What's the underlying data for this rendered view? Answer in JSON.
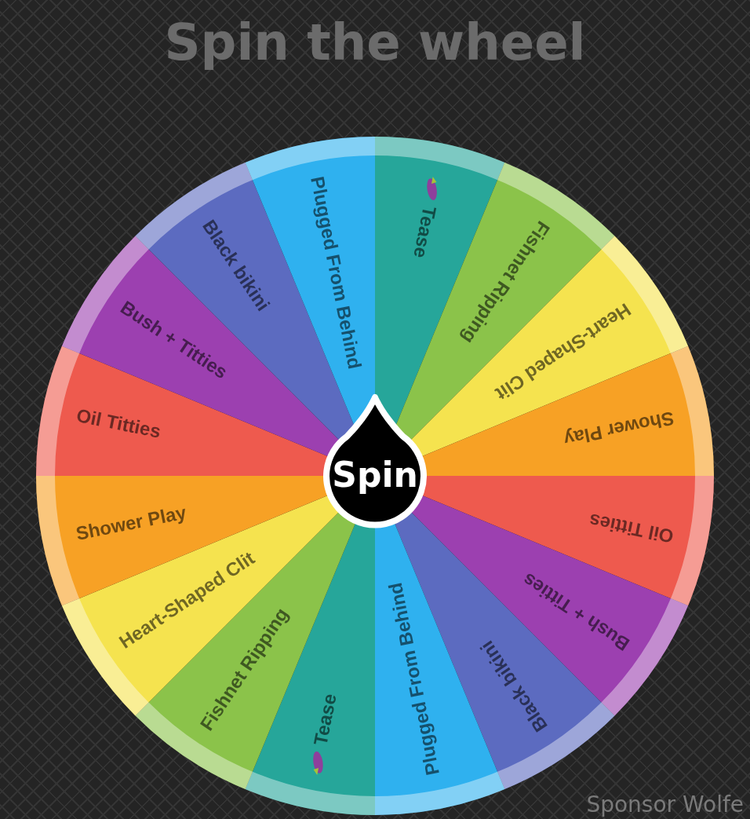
{
  "title": "Spin the wheel",
  "wheel": {
    "segments": [
      {
        "label": "Tease",
        "color": "#26a69a",
        "has_icon": true
      },
      {
        "label": "Fishnet Ripping",
        "color": "#8bc34a",
        "has_icon": false
      },
      {
        "label": "Heart-Shaped Clit",
        "color": "#f5e34f",
        "has_icon": false
      },
      {
        "label": "Shower Play",
        "color": "#f7a125",
        "has_icon": false
      },
      {
        "label": "Oil Titties",
        "color": "#ee5a4e",
        "has_icon": false
      },
      {
        "label": "Bush + Titties",
        "color": "#9c40b0",
        "has_icon": false
      },
      {
        "label": "Black bikini",
        "color": "#5c6bc0",
        "has_icon": false
      },
      {
        "label": "Plugged From Behind",
        "color": "#2fb1ef",
        "has_icon": false
      },
      {
        "label": "Tease",
        "color": "#26a69a",
        "has_icon": true
      },
      {
        "label": "Fishnet Ripping",
        "color": "#8bc34a",
        "has_icon": false
      },
      {
        "label": "Heart-Shaped Clit",
        "color": "#f5e34f",
        "has_icon": false
      },
      {
        "label": "Shower Play",
        "color": "#f7a125",
        "has_icon": false
      },
      {
        "label": "Oil Titties",
        "color": "#ee5a4e",
        "has_icon": false
      },
      {
        "label": "Bush + Titties",
        "color": "#9c40b0",
        "has_icon": false
      },
      {
        "label": "Black bikini",
        "color": "#5c6bc0",
        "has_icon": false
      },
      {
        "label": "Plugged From Behind",
        "color": "#2fb1ef",
        "has_icon": false
      }
    ],
    "spin_button": "Spin"
  },
  "sponsor": "Sponsor Wolfe"
}
